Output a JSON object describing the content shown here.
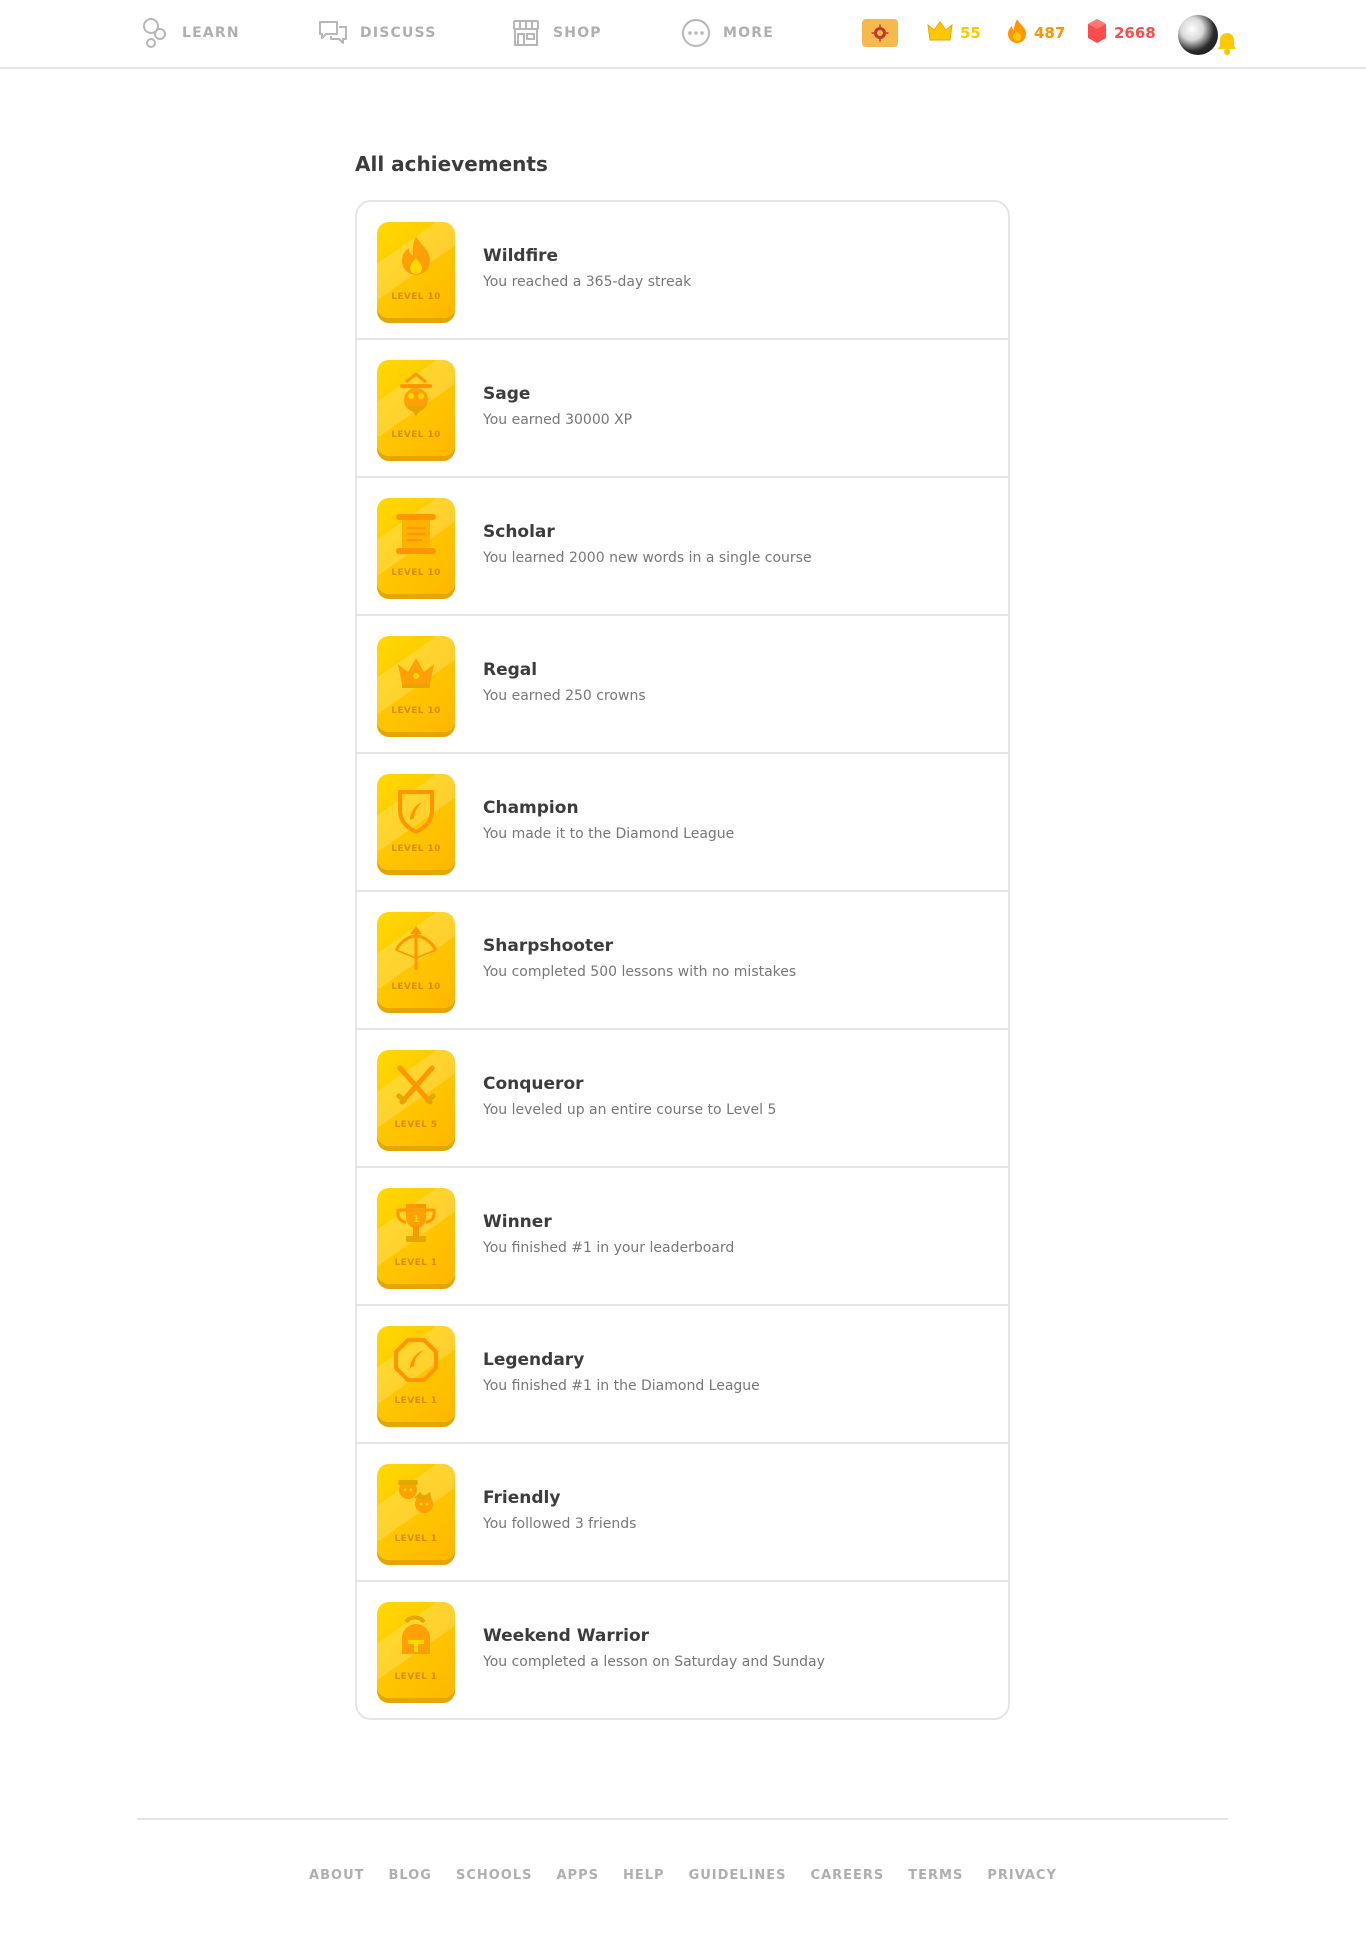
{
  "nav": {
    "learn": "LEARN",
    "discuss": "DISCUSS",
    "shop": "SHOP",
    "more": "MORE"
  },
  "stats": {
    "crowns": "55",
    "streak": "487",
    "gems": "2668"
  },
  "colors": {
    "accent_gold": "#ffc800",
    "streak_orange": "#ff9600",
    "gem_red": "#ff4b4b",
    "border": "#e5e5e5",
    "muted": "#afafaf"
  },
  "page": {
    "title": "All achievements"
  },
  "achievements": [
    {
      "title": "Wildfire",
      "desc": "You reached a 365-day streak",
      "level": "LEVEL 10",
      "icon": "flame-icon"
    },
    {
      "title": "Sage",
      "desc": "You earned 30000 XP",
      "level": "LEVEL 10",
      "icon": "owl-sage-icon"
    },
    {
      "title": "Scholar",
      "desc": "You learned 2000 new words in a single course",
      "level": "LEVEL 10",
      "icon": "scroll-icon"
    },
    {
      "title": "Regal",
      "desc": "You earned 250 crowns",
      "level": "LEVEL 10",
      "icon": "crown-icon"
    },
    {
      "title": "Champion",
      "desc": "You made it to the Diamond League",
      "level": "LEVEL 10",
      "icon": "shield-feather-icon"
    },
    {
      "title": "Sharpshooter",
      "desc": "You completed 500 lessons with no mistakes",
      "level": "LEVEL 10",
      "icon": "crossbow-icon"
    },
    {
      "title": "Conqueror",
      "desc": "You leveled up an entire course to Level 5",
      "level": "LEVEL 5",
      "icon": "crossed-swords-icon"
    },
    {
      "title": "Winner",
      "desc": "You finished #1 in your leaderboard",
      "level": "LEVEL 1",
      "icon": "trophy-icon"
    },
    {
      "title": "Legendary",
      "desc": "You finished #1 in the Diamond League",
      "level": "LEVEL 1",
      "icon": "octagon-feather-icon"
    },
    {
      "title": "Friendly",
      "desc": "You followed 3 friends",
      "level": "LEVEL 1",
      "icon": "friends-icon"
    },
    {
      "title": "Weekend Warrior",
      "desc": "You completed a lesson on Saturday and Sunday",
      "level": "LEVEL 1",
      "icon": "helmet-icon"
    }
  ],
  "footer": [
    "ABOUT",
    "BLOG",
    "SCHOOLS",
    "APPS",
    "HELP",
    "GUIDELINES",
    "CAREERS",
    "TERMS",
    "PRIVACY"
  ]
}
